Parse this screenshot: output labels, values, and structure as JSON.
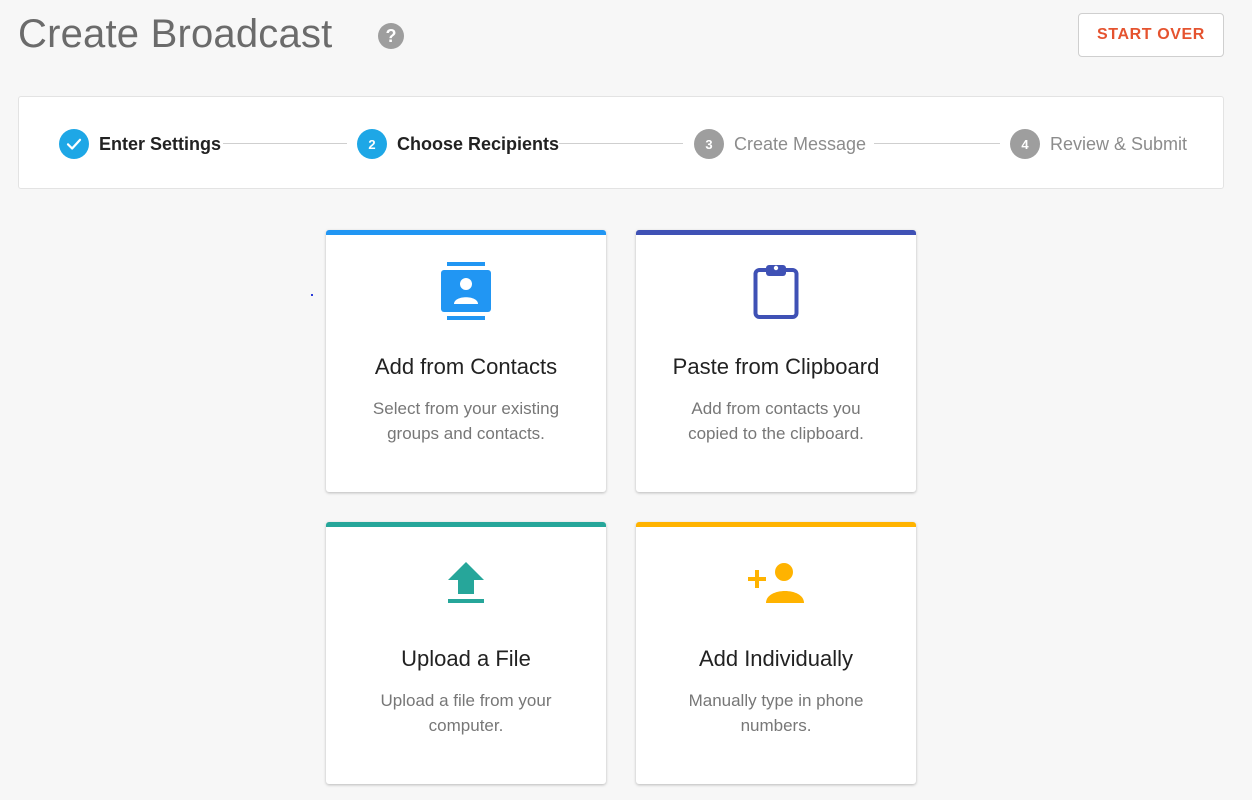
{
  "header": {
    "title": "Create Broadcast",
    "help_glyph": "?",
    "start_over_label": "START OVER",
    "start_over_color": "#e5532f"
  },
  "stepper": {
    "steps": [
      {
        "number": "",
        "label": "Enter Settings",
        "state": "complete",
        "icon": "check-icon"
      },
      {
        "number": "2",
        "label": "Choose Recipients",
        "state": "active"
      },
      {
        "number": "3",
        "label": "Create Message",
        "state": "inactive"
      },
      {
        "number": "4",
        "label": "Review & Submit",
        "state": "inactive"
      }
    ],
    "active_color": "#1ea7e6",
    "inactive_color": "#9e9e9e"
  },
  "options": [
    {
      "title": "Add from Contacts",
      "description": "Select from your existing groups and contacts.",
      "accent": "#2196f3",
      "icon": "contacts-icon"
    },
    {
      "title": "Paste from Clipboard",
      "description": "Add from contacts you copied to the clipboard.",
      "accent": "#3f51b5",
      "icon": "clipboard-icon"
    },
    {
      "title": "Upload a File",
      "description": "Upload a file from your computer.",
      "accent": "#26a69a",
      "icon": "upload-icon"
    },
    {
      "title": "Add Individually",
      "description": "Manually type in phone numbers.",
      "accent": "#ffb300",
      "icon": "add-person-icon"
    }
  ]
}
